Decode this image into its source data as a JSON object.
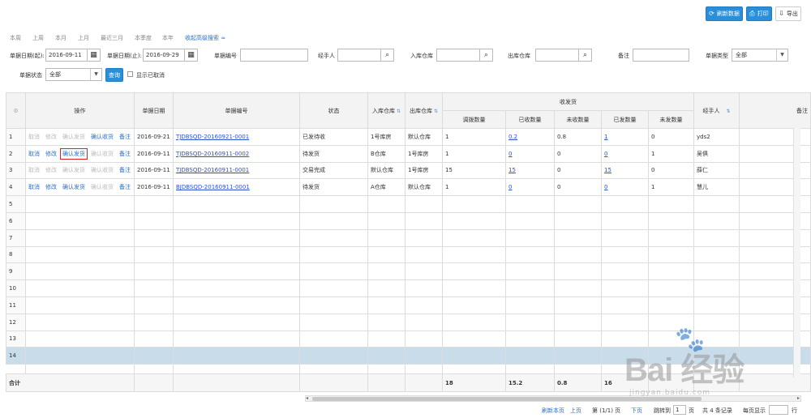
{
  "toolbar": {
    "refresh_label": "刷新数据",
    "print_label": "打印",
    "export_label": "导出"
  },
  "quick_dates": [
    "本周",
    "上周",
    "本月",
    "上月",
    "最近三月",
    "本季度",
    "本年"
  ],
  "toggle_search": "收起高级搜索 ≈",
  "filters": {
    "date_start_label": "单据日期(起):",
    "date_start_value": "2016-09-11",
    "date_end_label": "单据日期(止):",
    "date_end_value": "2016-09-29",
    "doc_no_label": "单据编号",
    "handler_label": "经手人",
    "in_wh_label": "入库仓库",
    "out_wh_label": "出库仓库",
    "remark_label": "备注",
    "doc_type_label": "单据类型",
    "doc_type_value": "全部",
    "doc_status_label": "单据状态",
    "doc_status_value": "全部",
    "query_label": "查询",
    "show_cancelled_label": "显示已取消"
  },
  "table": {
    "headers": {
      "op": "操作",
      "date": "单据日期",
      "no": "单据编号",
      "status": "状态",
      "in_wh": "入库仓库",
      "out_wh": "出库仓库",
      "group": "收发货",
      "qty": "调拨数量",
      "received": "已收数量",
      "unreceived": "未收数量",
      "sent": "已发数量",
      "unsent": "未发数量",
      "handler": "经手人",
      "remark": "备注"
    },
    "ops": [
      "取消",
      "修改",
      "确认发货",
      "确认收货",
      "备注"
    ],
    "rows": [
      {
        "n": "1",
        "date": "2016-09-21",
        "no": "TJDBSQD-20160921-0001",
        "status": "已发待收",
        "in_wh": "1号库房",
        "out_wh": "默认仓库",
        "qty": "1",
        "received": "0.2",
        "unreceived": "0.8",
        "sent": "1",
        "unsent": "0",
        "handler": "yds2"
      },
      {
        "n": "2",
        "date": "2016-09-11",
        "no": "TJDBSQD-20160911-0002",
        "status": "待发货",
        "in_wh": "B仓库",
        "out_wh": "1号库房",
        "qty": "1",
        "received": "0",
        "unreceived": "0",
        "sent": "0",
        "unsent": "1",
        "handler": "吴俱"
      },
      {
        "n": "3",
        "date": "2016-09-11",
        "no": "TJDBSQD-20160911-0001",
        "status": "交易完成",
        "in_wh": "默认仓库",
        "out_wh": "1号库房",
        "qty": "15",
        "received": "15",
        "unreceived": "0",
        "sent": "15",
        "unsent": "0",
        "handler": "薛仁"
      },
      {
        "n": "4",
        "date": "2016-09-11",
        "no": "BJDBSQD-20160911-0001",
        "status": "待发货",
        "in_wh": "A仓库",
        "out_wh": "默认仓库",
        "qty": "1",
        "received": "0",
        "unreceived": "0",
        "sent": "0",
        "unsent": "1",
        "handler": "慧儿"
      }
    ],
    "empty_rows": [
      "5",
      "6",
      "7",
      "8",
      "9",
      "10",
      "11",
      "12",
      "13",
      "14"
    ],
    "sum": {
      "label": "合计",
      "qty": "18",
      "received": "15.2",
      "unreceived": "0.8",
      "sent": "16"
    }
  },
  "pager": {
    "refresh": "刷新本页",
    "prev": "上页",
    "page_info": "第 (1/1) 页",
    "next": "下页",
    "jump_label": "跳转到",
    "jump_value": "1",
    "page_unit": "页",
    "total": "共 4 条记录",
    "per_page_label": "每页显示",
    "per_page_unit": "行"
  },
  "watermark": {
    "text": "Bai 经验",
    "sub": "jingyan.baidu.com"
  }
}
